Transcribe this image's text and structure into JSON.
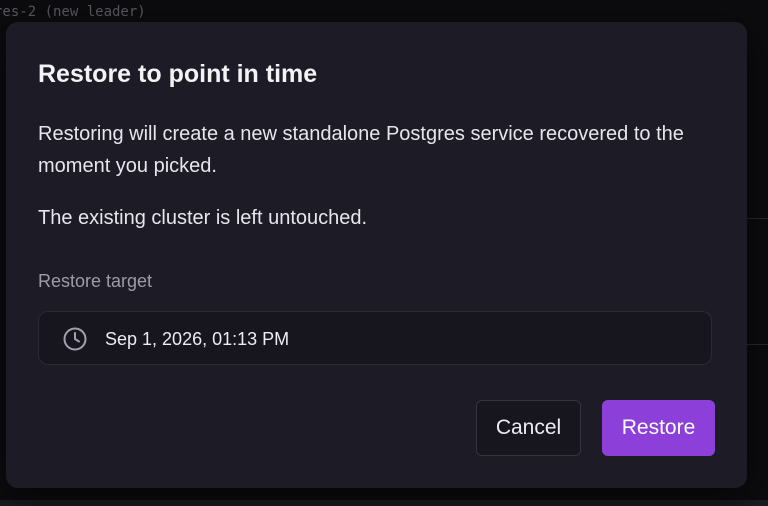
{
  "background": {
    "terminal_line": "res-2 (new leader)"
  },
  "dialog": {
    "title": "Restore to point in time",
    "description": "Restoring will create a new standalone Postgres service recovered to the moment you picked.",
    "note": "The existing cluster is left untouched.",
    "restore_target": {
      "label": "Restore target",
      "value": "Sep 1, 2026, 01:13 PM",
      "icon": "clock-icon"
    },
    "buttons": {
      "cancel_label": "Cancel",
      "restore_label": "Restore"
    }
  },
  "colors": {
    "accent": "#8c40d9",
    "dialog_background": "#1c1b26",
    "page_background": "#0c0c0f"
  }
}
